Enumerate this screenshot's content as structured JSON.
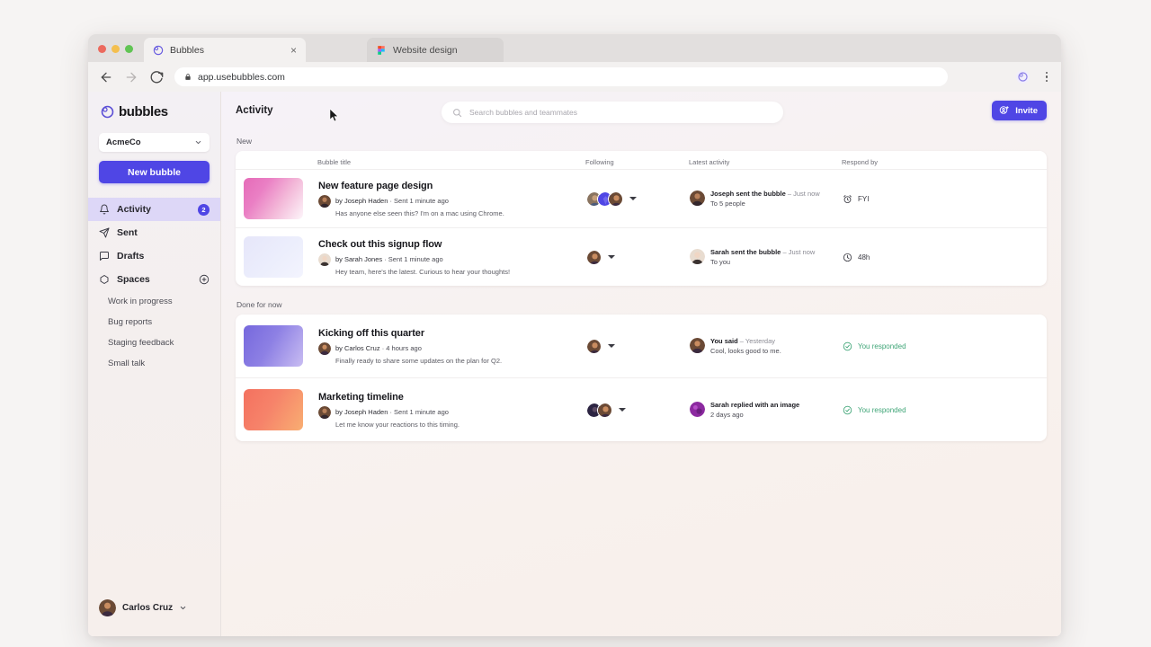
{
  "browser": {
    "tabs": [
      {
        "title": "Bubbles",
        "favicon": "bubbles-icon",
        "active": true,
        "close": "×"
      },
      {
        "title": "Website design",
        "favicon": "figma-icon",
        "active": false
      }
    ],
    "toolbar": {
      "back_icon": "back-arrow-icon",
      "forward_icon": "forward-arrow-icon",
      "reload_icon": "reload-icon",
      "lock_icon": "lock-icon",
      "url": "app.usebubbles.com",
      "extension_icon": "bubbles-extension-icon",
      "menu_icon": "kebab-menu-icon"
    }
  },
  "sidebar": {
    "brand": "bubbles",
    "org": {
      "name": "AcmeCo",
      "chevron": "⌄"
    },
    "new_bubble_label": "New bubble",
    "nav": [
      {
        "label": "Activity",
        "icon": "bell-icon",
        "badge": "2",
        "active": true
      },
      {
        "label": "Sent",
        "icon": "send-icon",
        "active": false
      },
      {
        "label": "Drafts",
        "icon": "draft-icon",
        "active": false
      },
      {
        "label": "Spaces",
        "icon": "spaces-icon",
        "action_icon": "plus-circle-icon",
        "active": false
      }
    ],
    "spaces": [
      "Work in progress",
      "Bug reports",
      "Staging feedback",
      "Small talk"
    ],
    "user": {
      "name": "Carlos Cruz",
      "chevron": "⌄",
      "avatar": "carlos-avatar"
    }
  },
  "header": {
    "title": "Activity",
    "search_placeholder": "Search bubbles and teammates",
    "search_icon": "search-icon",
    "invite_label": "Invite",
    "invite_icon": "add-person-icon"
  },
  "columns": {
    "title": "Bubble title",
    "following": "Following",
    "activity": "Latest activity",
    "respond": "Respond by"
  },
  "sections": [
    {
      "label": "New",
      "rows": [
        {
          "title": "New feature page design",
          "author": "by Joseph Haden",
          "time": "Sent 1 minute ago",
          "snippet": "Has anyone else seen this? I'm on a mac using Chrome.",
          "thumb_colors": [
            "#e56bb8",
            "#f3b8d8",
            "#fdf6fa"
          ],
          "following_count": 3,
          "activity_actor": "Joseph sent the bubble",
          "activity_time": "Just now",
          "activity_detail": "To 5 people",
          "respond_icon": "alarm-clock-icon",
          "respond_label": "FYI",
          "respond_state": "pending"
        },
        {
          "title": "Check out this signup flow",
          "author": "by Sarah Jones",
          "time": "Sent 1 minute ago",
          "snippet": "Hey team, here's the latest. Curious to hear your thoughts!",
          "thumb_colors": [
            "#e6e6fa",
            "#eef0fd",
            "#f2f3fe"
          ],
          "following_count": 1,
          "activity_actor": "Sarah sent the bubble",
          "activity_time": "Just now",
          "activity_detail": "To you",
          "respond_icon": "clock-icon",
          "respond_label": "48h",
          "respond_state": "pending"
        }
      ]
    },
    {
      "label": "Done for now",
      "rows": [
        {
          "title": "Kicking off this quarter",
          "author": "by Carlos Cruz",
          "time": "4 hours ago",
          "snippet": "Finally ready to share some updates on the plan for Q2.",
          "thumb_colors": [
            "#7668dd",
            "#9a8ce8",
            "#c9bdf2"
          ],
          "following_count": 1,
          "activity_actor": "You said",
          "activity_time": "Yesterday",
          "activity_detail": "Cool, looks good to me.",
          "respond_icon": "check-circle-icon",
          "respond_label": "You responded",
          "respond_state": "done"
        },
        {
          "title": "Marketing timeline",
          "author": "by Joseph Haden",
          "time": "Sent 1 minute ago",
          "snippet": "Let me know your reactions to this timing.",
          "thumb_colors": [
            "#f4715f",
            "#f78a6b",
            "#f9ae72"
          ],
          "following_count": 2,
          "activity_actor": "Sarah replied with an image",
          "activity_time": "",
          "activity_detail": "2 days ago",
          "respond_icon": "check-circle-icon",
          "respond_label": "You responded",
          "respond_state": "done"
        }
      ]
    }
  ],
  "colors": {
    "accent": "#4f46e5",
    "accent_soft": "#ddd7f7",
    "success": "#3fa577",
    "page_bg": "#f7f2f2"
  }
}
